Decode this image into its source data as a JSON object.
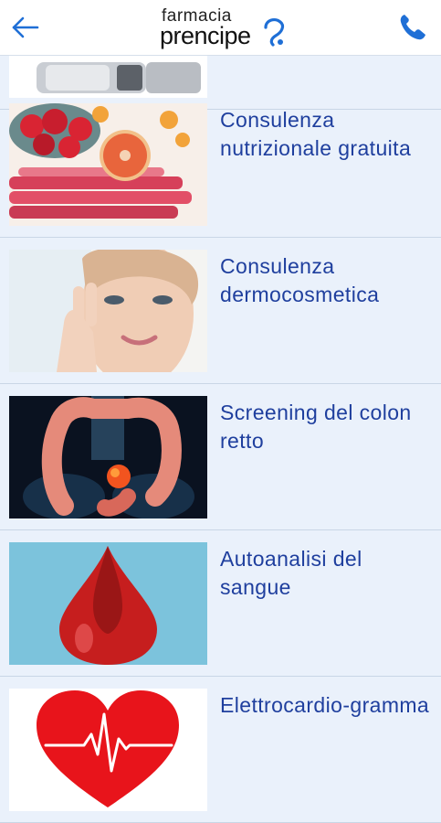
{
  "header": {
    "logo_top": "farmacia",
    "logo_bottom": "prencipe",
    "back_icon": "arrow-left-icon",
    "phone_icon": "phone-icon",
    "accent_color": "#1f6fd6"
  },
  "colors": {
    "background": "#eaf1fb",
    "title_text": "#1f3f9e",
    "divider": "#c9d6e6"
  },
  "services": [
    {
      "title": "",
      "image": "device-image"
    },
    {
      "title": "Consulenza nutrizionale gratuita",
      "image": "fruit-image"
    },
    {
      "title": "Consulenza dermocosmetica",
      "image": "face-skin-image"
    },
    {
      "title": "Screening del colon retto",
      "image": "colon-xray-image"
    },
    {
      "title": "Autoanalisi del sangue",
      "image": "blood-drop-image"
    },
    {
      "title": "Elettrocardio-gramma",
      "image": "heart-ecg-image"
    }
  ]
}
